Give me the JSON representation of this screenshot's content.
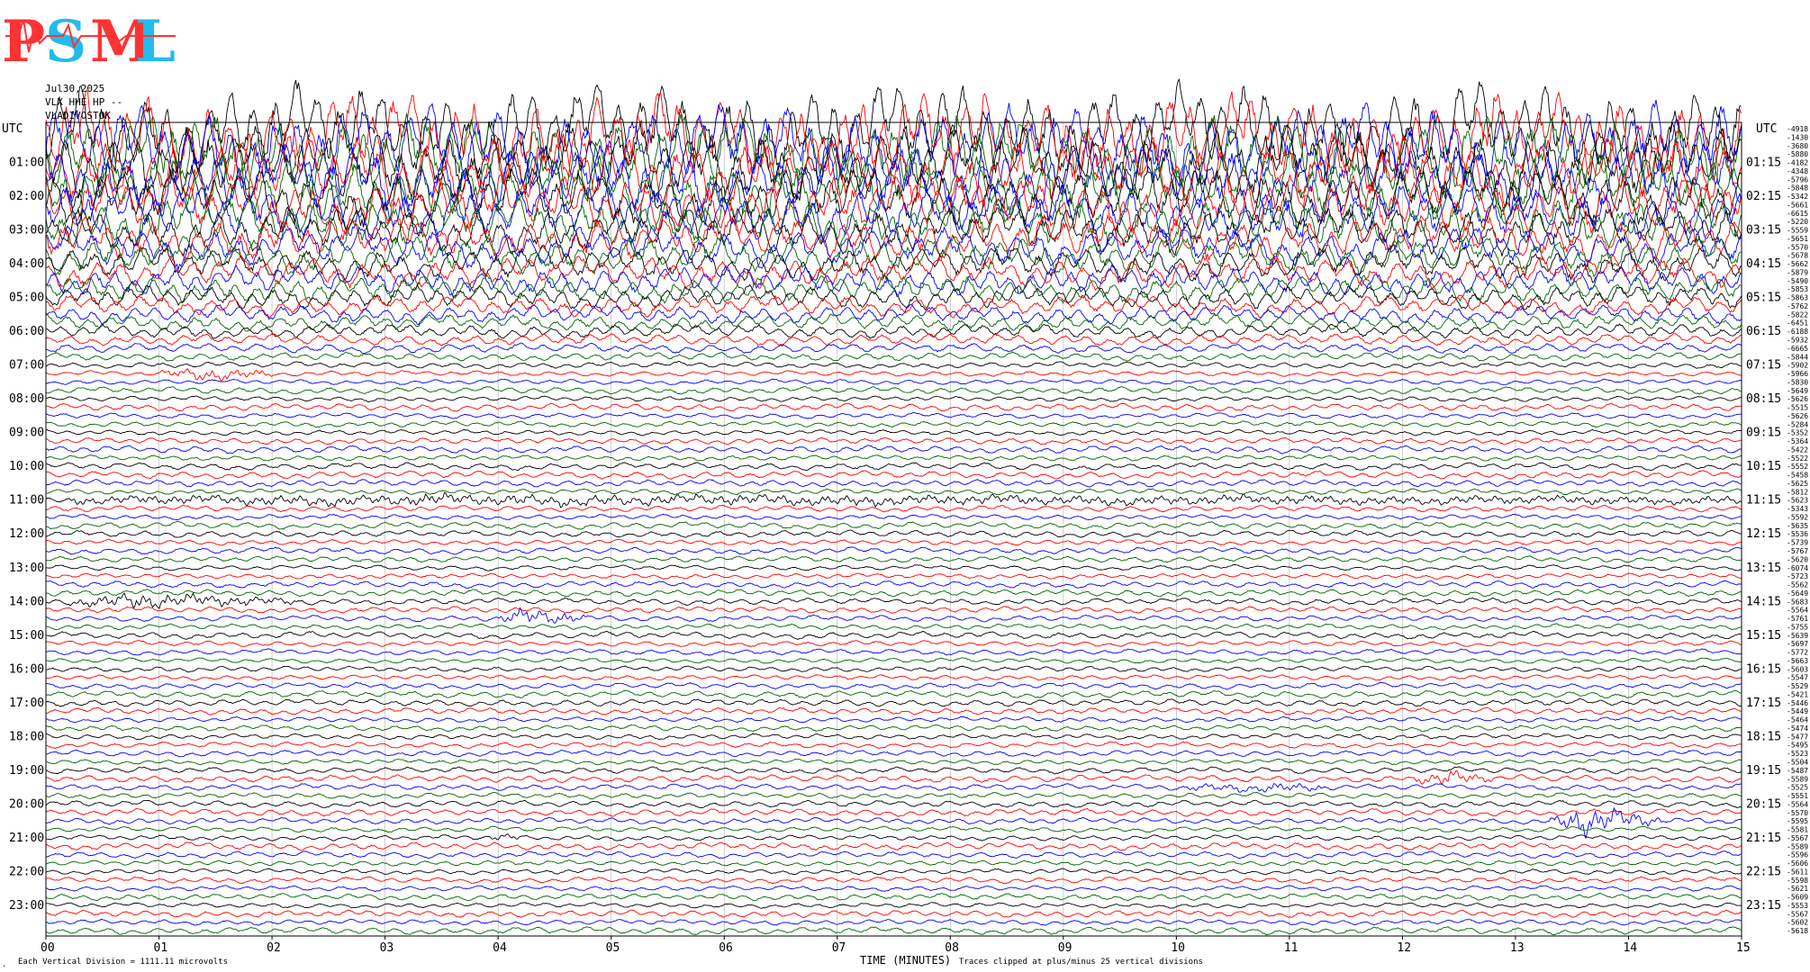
{
  "header": {
    "date": "Jul30,2025",
    "station": "VLX HHE HP --",
    "network": "VLADIVOSTOK"
  },
  "logo": {
    "text": "PSML",
    "letters": [
      "P",
      "S",
      "M",
      "L"
    ]
  },
  "axes": {
    "left_title": "UTC",
    "right_title": "UTC",
    "left_hours": [
      "01:00",
      "02:00",
      "03:00",
      "04:00",
      "05:00",
      "06:00",
      "07:00",
      "08:00",
      "09:00",
      "10:00",
      "11:00",
      "12:00",
      "13:00",
      "14:00",
      "15:00",
      "16:00",
      "17:00",
      "18:00",
      "19:00",
      "20:00",
      "21:00",
      "22:00",
      "23:00"
    ],
    "right_hours": [
      "01:15",
      "02:15",
      "03:15",
      "04:15",
      "05:15",
      "06:15",
      "07:15",
      "08:15",
      "09:15",
      "10:15",
      "11:15",
      "12:15",
      "13:15",
      "14:15",
      "15:15",
      "16:15",
      "17:15",
      "18:15",
      "19:15",
      "20:15",
      "21:15",
      "22:15",
      "23:15"
    ],
    "x_ticks": [
      "00",
      "01",
      "02",
      "03",
      "04",
      "05",
      "06",
      "07",
      "08",
      "09",
      "10",
      "11",
      "12",
      "13",
      "14",
      "15"
    ],
    "x_label": "TIME (MINUTES)"
  },
  "footer": {
    "scale_note": "Each Vertical Division = 1111.11 microvolts",
    "clip_note": "Traces clipped at plus/minus 25 vertical divisions"
  },
  "chart_data": {
    "type": "line",
    "title": "",
    "xlabel": "TIME (MINUTES)",
    "ylabel": "UTC",
    "xlim": [
      0,
      15
    ],
    "trace_minutes": 15,
    "traces_per_hour": 4,
    "trace_count": 96,
    "color_cycle": [
      "#000000",
      "#ff0000",
      "#0000ff",
      "#006400"
    ],
    "clipped_until_hour": 7,
    "offsets": [
      "-4918",
      "-1430",
      "-3680",
      "-5880",
      "-4182",
      "-4348",
      "-5796",
      "-5848",
      "-5342",
      "-5661",
      "-6615",
      "-5220",
      "-5559",
      "-5651",
      "-5570",
      "-5678",
      "-5662",
      "-5879",
      "-5490",
      "-5853",
      "-5863",
      "-5762",
      "-5822",
      "-6451",
      "-6188",
      "-5932",
      "-6665",
      "-5844",
      "-5902",
      "-5966",
      "-5830",
      "-5649",
      "-5626",
      "-5515",
      "-5626",
      "-5284",
      "-5352",
      "-5364",
      "-5422",
      "-5522",
      "-5552",
      "-5458",
      "-5625",
      "-5812",
      "-5623",
      "-5343",
      "-5592",
      "-5635",
      "-5536",
      "-5739",
      "-5767",
      "-5620",
      "-6074",
      "-5723",
      "-5562",
      "-5649",
      "-5683",
      "-5564",
      "-5761",
      "-5755",
      "-5639",
      "-5697",
      "-5772",
      "-5663",
      "-5603",
      "-5547",
      "-5529",
      "-5421",
      "-5446",
      "-5449",
      "-5464",
      "-5474",
      "-5477",
      "-5495",
      "-5523",
      "-5504",
      "-5487",
      "-5589",
      "-5525",
      "-5551",
      "-5564",
      "-5570",
      "-5595",
      "-5581",
      "-5567",
      "-5589",
      "-5596",
      "-5606",
      "-5611",
      "-5598",
      "-5621",
      "-5609",
      "-5553",
      "-5567",
      "-5602",
      "-5618"
    ],
    "events": [
      {
        "trace": 29,
        "start_min": 1.0,
        "end_min": 2.0,
        "peak_min": 1.45,
        "amp": 2.6
      },
      {
        "trace": 44,
        "start_min": 0.2,
        "end_min": 15.0,
        "peak_min": 3.5,
        "amp": 1.5
      },
      {
        "trace": 56,
        "start_min": 0.2,
        "end_min": 2.2,
        "peak_min": 0.8,
        "amp": 2.4
      },
      {
        "trace": 58,
        "start_min": 4.0,
        "end_min": 4.8,
        "peak_min": 4.25,
        "amp": 2.8
      },
      {
        "trace": 77,
        "start_min": 12.1,
        "end_min": 12.8,
        "peak_min": 12.35,
        "amp": 2.2
      },
      {
        "trace": 78,
        "start_min": 10.1,
        "end_min": 11.3,
        "peak_min": 10.8,
        "amp": 1.6
      },
      {
        "trace": 82,
        "start_min": 13.3,
        "end_min": 14.3,
        "peak_min": 13.6,
        "amp": 5.0
      },
      {
        "trace": 84,
        "start_min": 3.9,
        "end_min": 4.2,
        "peak_min": 4.05,
        "amp": 1.3
      }
    ]
  }
}
